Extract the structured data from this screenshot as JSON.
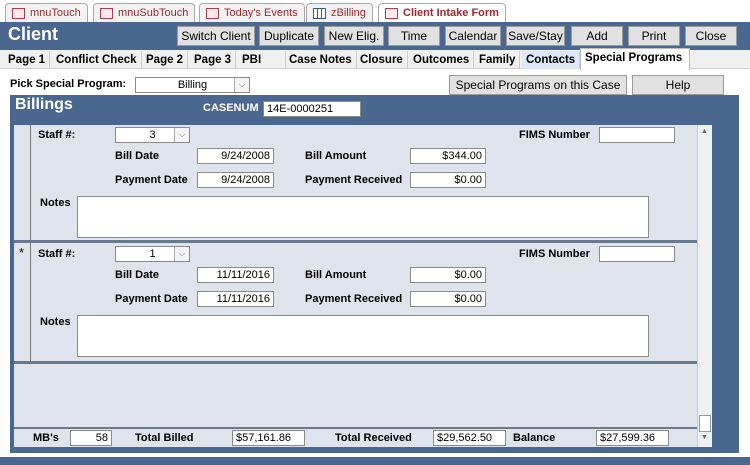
{
  "doc_tabs": [
    {
      "label": "mnuTouch",
      "icon": "form-icon"
    },
    {
      "label": "mnuSubTouch",
      "icon": "form-icon"
    },
    {
      "label": "Today's Events",
      "icon": "form-icon"
    },
    {
      "label": "zBilling",
      "icon": "table-icon"
    },
    {
      "label": "Client Intake Form",
      "icon": "form-icon"
    }
  ],
  "header": {
    "title": "Client",
    "buttons": [
      "Switch Client",
      "Duplicate",
      "New Elig.",
      "Time",
      "Calendar",
      "Save/Stay",
      "Add",
      "Print",
      "Close"
    ]
  },
  "page_tabs": [
    "Page 1",
    "Conflict Check",
    "Page 2",
    "Page 3",
    "PBI",
    "Case Notes",
    "Closure",
    "Outcomes",
    "Family",
    "Contacts",
    "Special Programs"
  ],
  "pick": {
    "label": "Pick Special Program:",
    "value": "Billing",
    "special_button": "Special Programs on this Case",
    "help_button": "Help"
  },
  "billings": {
    "title": "Billings",
    "casenum_label": "CASENUM",
    "casenum": "14E-0000251"
  },
  "labels": {
    "staff": "Staff #:",
    "fims": "FIMS Number",
    "bill_date": "Bill Date",
    "bill_amount": "Bill Amount",
    "payment_date": "Payment Date",
    "payment_received": "Payment Received",
    "notes": "Notes",
    "new_marker": "*"
  },
  "records": [
    {
      "staff": "3",
      "fims": "",
      "bill_date": "9/24/2008",
      "bill_amount": "$344.00",
      "payment_date": "9/24/2008",
      "payment_received": "$0.00",
      "notes": ""
    },
    {
      "staff": "1",
      "fims": "",
      "bill_date": "11/11/2016",
      "bill_amount": "$0.00",
      "payment_date": "11/11/2016",
      "payment_received": "$0.00",
      "notes": ""
    }
  ],
  "footer": {
    "mbs_label": "MB's",
    "mbs": "58",
    "total_billed_label": "Total Billed",
    "total_billed": "$57,161.86",
    "total_received_label": "Total Received",
    "total_received": "$29,562.50",
    "balance_label": "Balance",
    "balance": "$27,599.36"
  }
}
